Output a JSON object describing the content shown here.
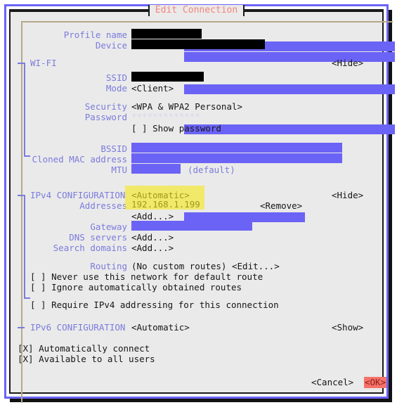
{
  "window": {
    "title": "Edit Connection",
    "accent_blue": "#6b63f5",
    "label_blue": "#7b7bdd",
    "title_red": "#f4847c",
    "ok_bg": "#f4726a",
    "highlight_yellow": "#f6e91c",
    "background": "#eaeaea"
  },
  "general": {
    "profile_name_label": "Profile name",
    "profile_name_value": "",
    "device_label": "Device",
    "device_value": ""
  },
  "wifi": {
    "section_label": "WI-FI",
    "toggle_label": "<Hide>",
    "ssid_label": "SSID",
    "ssid_value": "",
    "mode_label": "Mode",
    "mode_value": "<Client>",
    "security_label": "Security",
    "security_value": "<WPA & WPA2 Personal>",
    "password_label": "Password",
    "password_value": "*************",
    "show_password_label": "[ ] Show password",
    "bssid_label": "BSSID",
    "bssid_value": "",
    "cloned_mac_label": "Cloned MAC address",
    "cloned_mac_value": "",
    "mtu_label": "MTU",
    "mtu_value": "",
    "mtu_hint": "(default)"
  },
  "ipv4": {
    "section_label": "IPv4 CONFIGURATION",
    "mode_value": "<Automatic>",
    "toggle_label": "<Hide>",
    "addresses_label": "Addresses",
    "addresses_value": "192.168.1.199",
    "addresses_remove": "<Remove>",
    "addresses_add": "<Add...>",
    "gateway_label": "Gateway",
    "gateway_value": "",
    "dns_label": "DNS servers",
    "dns_value": "<Add...>",
    "search_domains_label": "Search domains",
    "search_domains_value": "<Add...>",
    "routing_label": "Routing",
    "routing_value": "(No custom routes) <Edit...>",
    "never_default_route": "[ ] Never use this network for default route",
    "ignore_auto_routes": "[ ] Ignore automatically obtained routes",
    "require_ipv4": "[ ] Require IPv4 addressing for this connection"
  },
  "ipv6": {
    "section_label": "IPv6 CONFIGURATION",
    "mode_value": "<Automatic>",
    "toggle_label": "<Show>"
  },
  "options": {
    "auto_connect": "[X] Automatically connect",
    "available_all_users": "[X] Available to all users"
  },
  "actions": {
    "cancel_label": "<Cancel>",
    "ok_label": "<OK>"
  }
}
